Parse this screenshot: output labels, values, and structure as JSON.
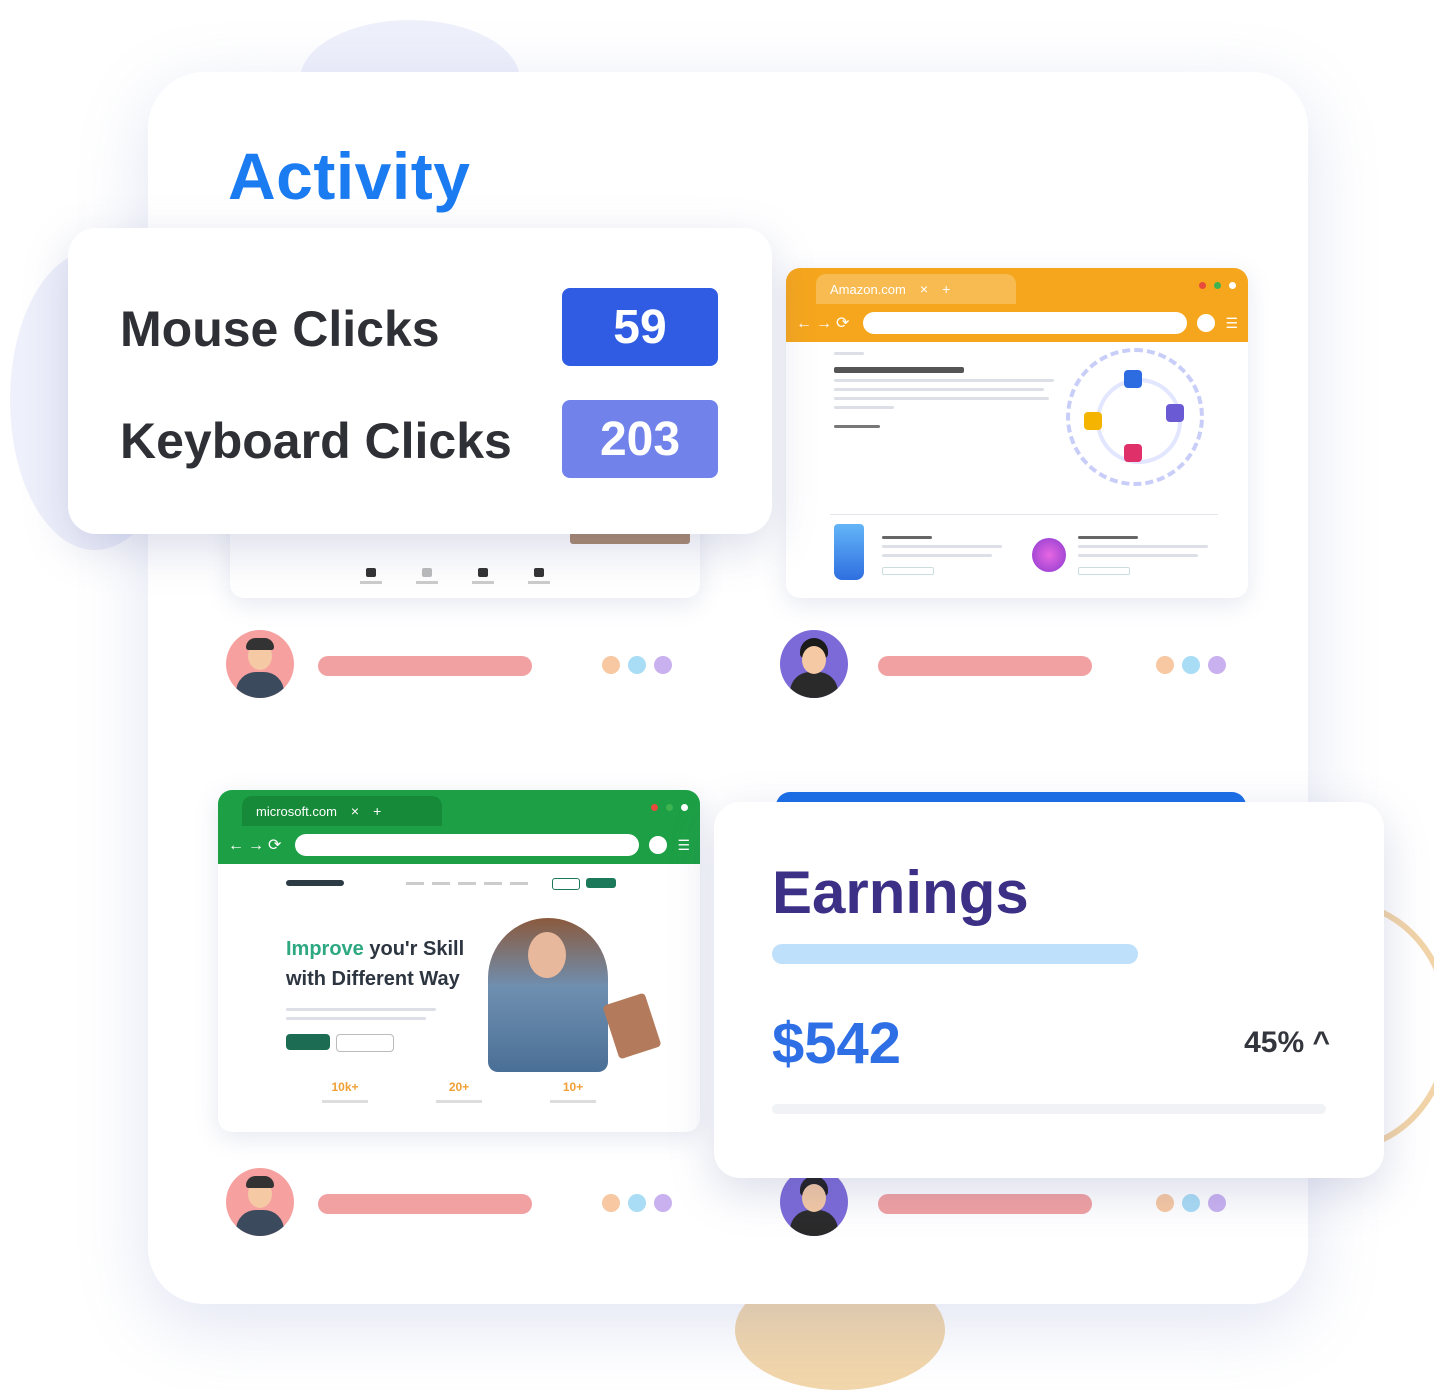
{
  "activity": {
    "title": "Activity"
  },
  "clicks": {
    "mouse": {
      "label": "Mouse Clicks",
      "value": "59"
    },
    "keyboard": {
      "label": "Keyboard Clicks",
      "value": "203"
    }
  },
  "screenshots": {
    "top_right": {
      "tab_label": "Amazon.com",
      "color": "#f6a61d"
    },
    "bottom_left": {
      "tab_label": "microsoft.com",
      "color": "#1da045",
      "hero_highlight": "Improve",
      "hero_rest": " you'r Skill",
      "hero_line2": "with Different Way",
      "stats": [
        "10k+",
        "20+",
        "10+"
      ]
    },
    "bottom_right": {
      "color": "#1a6ee8"
    }
  },
  "earnings": {
    "title": "Earnings",
    "amount": "$542",
    "change": "45% ^",
    "progress_fraction": 0.45
  },
  "users": [
    {
      "avatar": "male-avatar-icon"
    },
    {
      "avatar": "female-avatar-icon"
    },
    {
      "avatar": "male-avatar-icon"
    },
    {
      "avatar": "female-avatar-icon"
    }
  ],
  "status_dot_colors": [
    "#f7c8a2",
    "#a9dcf5",
    "#c9b1f0"
  ],
  "accent_colors": {
    "title_blue": "#1b7bf0",
    "earnings_purple": "#3c2f86",
    "amount_blue": "#2f6fe6"
  }
}
